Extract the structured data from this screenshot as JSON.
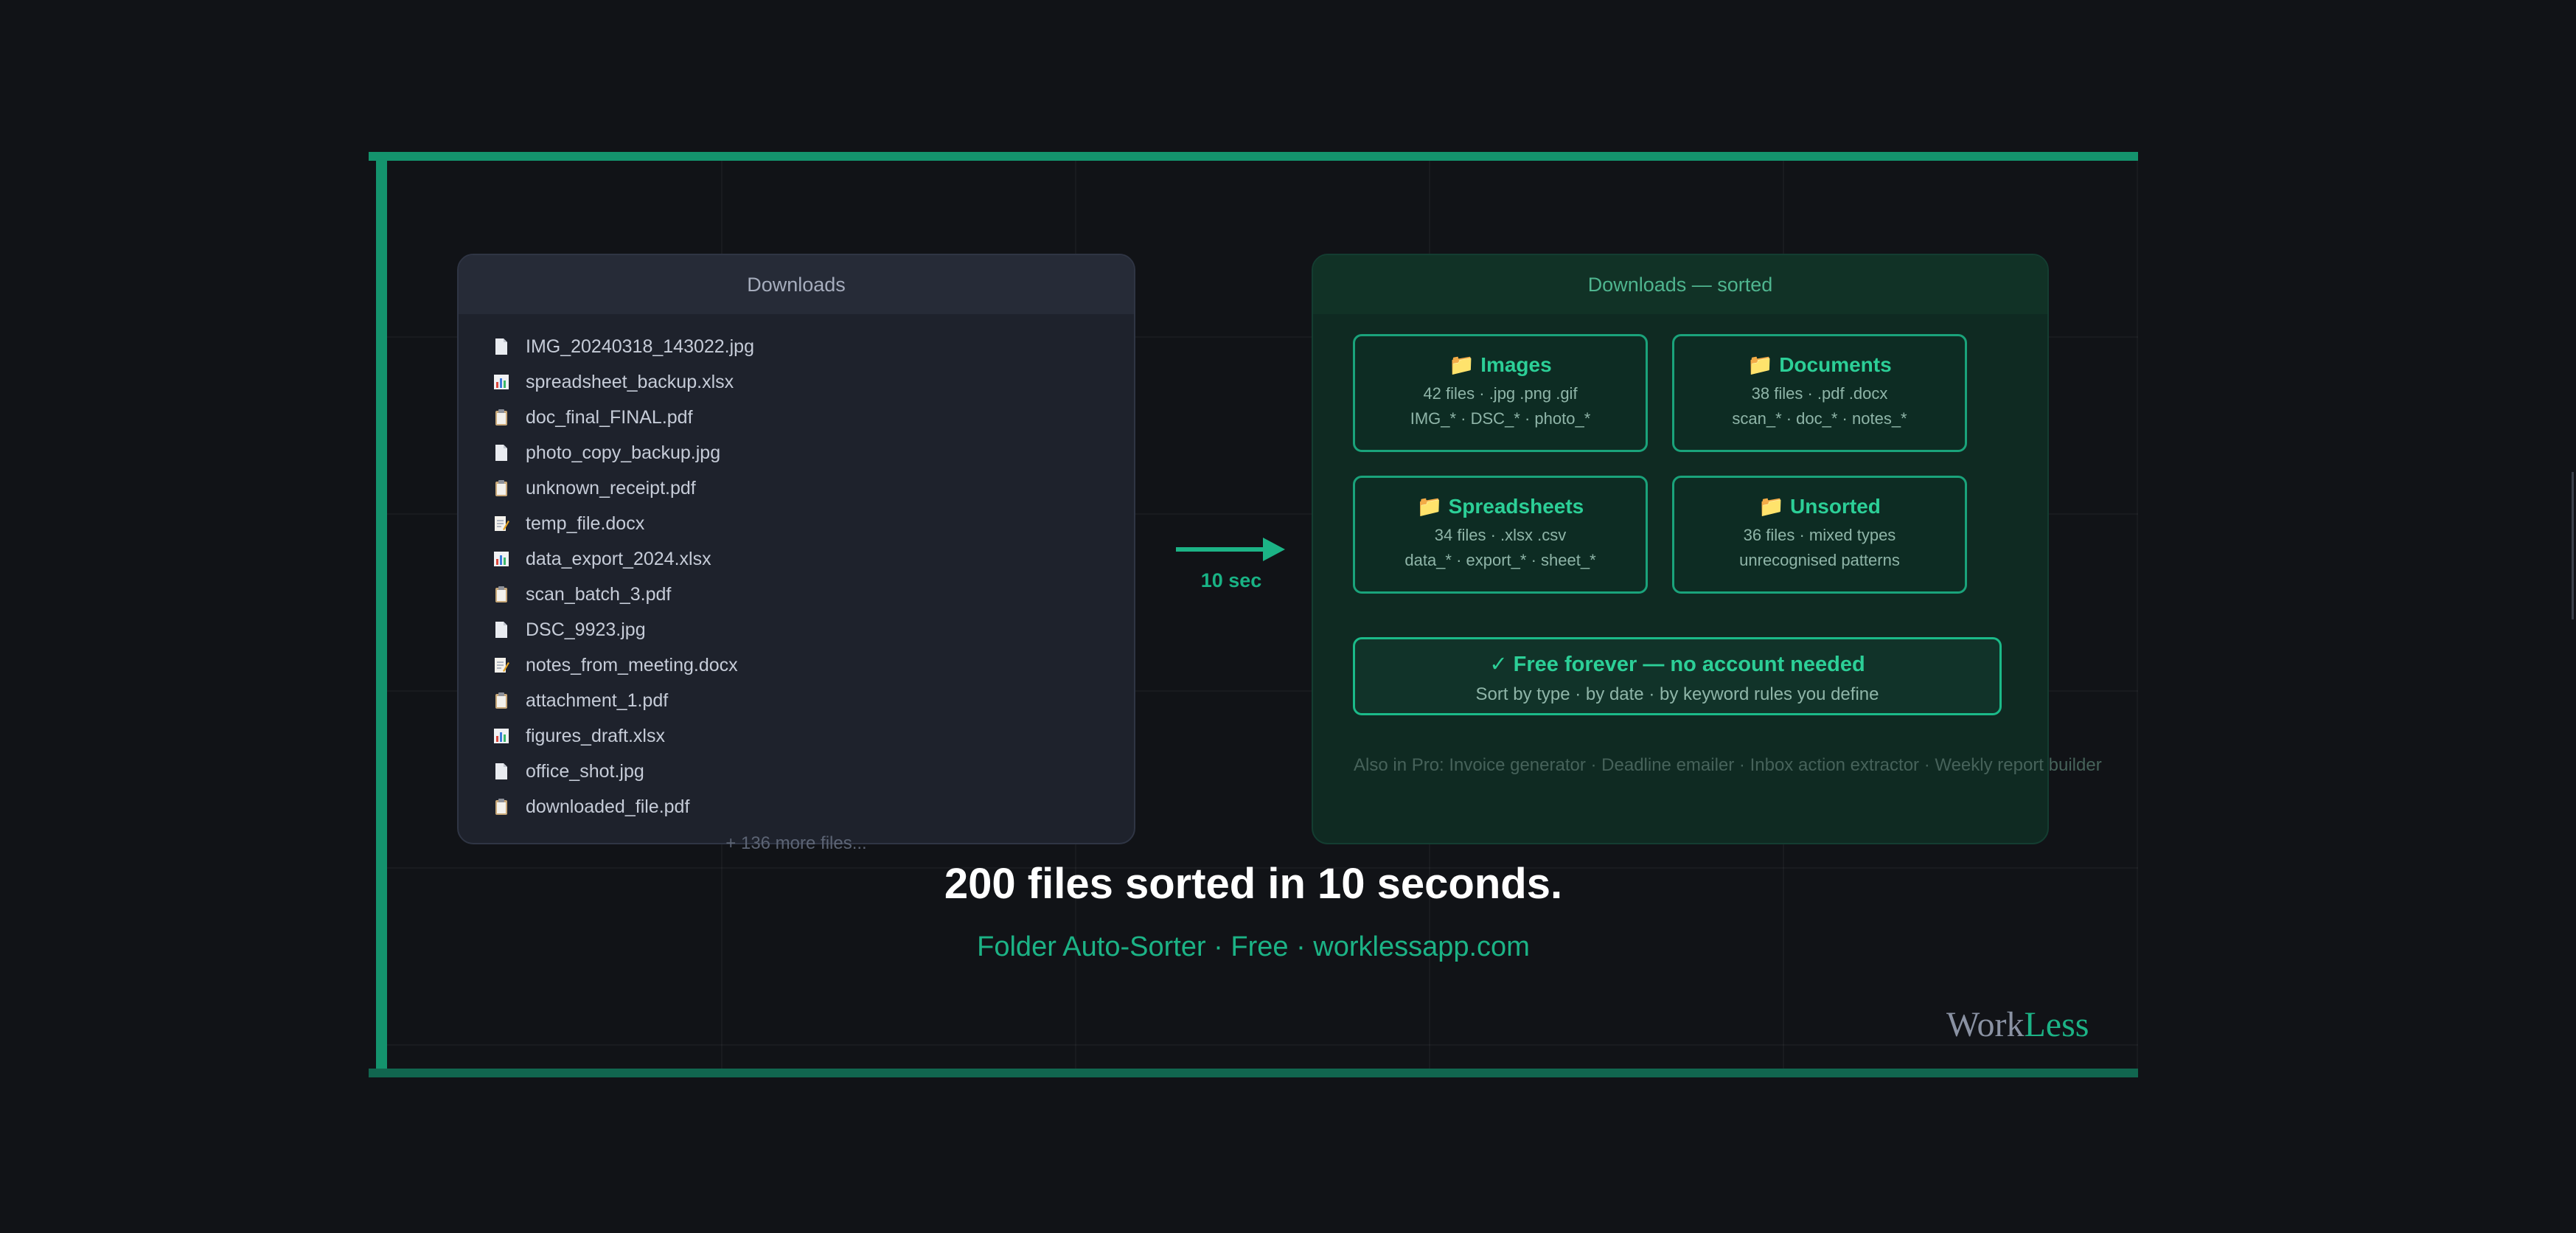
{
  "left_panel": {
    "title": "Downloads",
    "files": [
      {
        "name": "IMG_20240318_143022.jpg",
        "icon": "file-icon"
      },
      {
        "name": "spreadsheet_backup.xlsx",
        "icon": "chart-icon"
      },
      {
        "name": "doc_final_FINAL.pdf",
        "icon": "clipboard-icon"
      },
      {
        "name": "photo_copy_backup.jpg",
        "icon": "file-icon"
      },
      {
        "name": "unknown_receipt.pdf",
        "icon": "clipboard-icon"
      },
      {
        "name": "temp_file.docx",
        "icon": "memo-icon"
      },
      {
        "name": "data_export_2024.xlsx",
        "icon": "chart-icon"
      },
      {
        "name": "scan_batch_3.pdf",
        "icon": "clipboard-icon"
      },
      {
        "name": "DSC_9923.jpg",
        "icon": "file-icon"
      },
      {
        "name": "notes_from_meeting.docx",
        "icon": "memo-icon"
      },
      {
        "name": "attachment_1.pdf",
        "icon": "clipboard-icon"
      },
      {
        "name": "figures_draft.xlsx",
        "icon": "chart-icon"
      },
      {
        "name": "office_shot.jpg",
        "icon": "file-icon"
      },
      {
        "name": "downloaded_file.pdf",
        "icon": "clipboard-icon"
      }
    ],
    "more": "+ 136 more files..."
  },
  "arrow_label": "10 sec",
  "right_panel": {
    "title": "Downloads — sorted",
    "categories": [
      {
        "name": "Images",
        "info": "42 files · .jpg .png .gif",
        "patterns": "IMG_* · DSC_* · photo_*"
      },
      {
        "name": "Documents",
        "info": "38 files · .pdf .docx",
        "patterns": "scan_* · doc_* · notes_*"
      },
      {
        "name": "Spreadsheets",
        "info": "34 files · .xlsx .csv",
        "patterns": "data_* · export_* · sheet_*"
      },
      {
        "name": "Unsorted",
        "info": "36 files · mixed types",
        "patterns": "unrecognised patterns"
      }
    ],
    "free_title": "✓ Free forever — no account needed",
    "free_sub": "Sort by type · by date · by keyword rules you define",
    "also": "Also in Pro: Invoice generator · Deadline emailer · Inbox action extractor · Weekly report builder"
  },
  "headline": "200 files sorted in 10 seconds.",
  "tagline": "Folder Auto-Sorter · Free · worklessapp.com",
  "brand": {
    "part1": "Work",
    "part2": "Less"
  },
  "colors": {
    "accent": "#14936d",
    "accent_text": "#2ccf97",
    "background": "#111317"
  }
}
